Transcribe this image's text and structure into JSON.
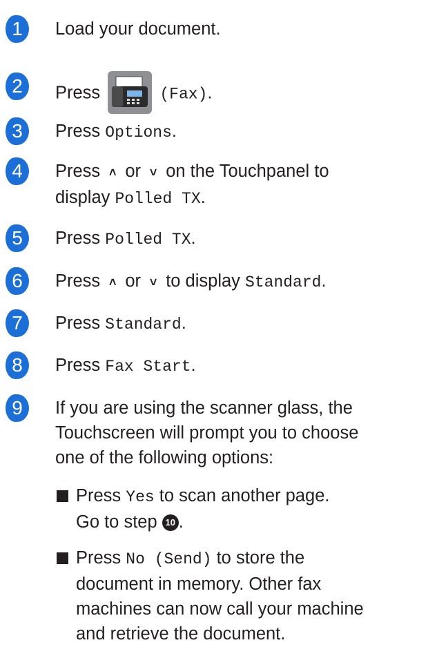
{
  "steps": [
    {
      "num": "1",
      "text": "Load your document."
    },
    {
      "num": "2",
      "pre": "Press",
      "post_mono": "(Fax)",
      "post": "."
    },
    {
      "num": "3",
      "pre": "Press ",
      "mono": "Options",
      "post": "."
    },
    {
      "num": "4",
      "pre": "Press ",
      "or": " or ",
      "mid": " on the Touchpanel to",
      "line2_pre": "display ",
      "line2_mono": "Polled TX",
      "line2_post": "."
    },
    {
      "num": "5",
      "pre": "Press ",
      "mono": "Polled TX",
      "post": "."
    },
    {
      "num": "6",
      "pre": "Press ",
      "or": " or ",
      "mid": " to display ",
      "mono": "Standard",
      "post": "."
    },
    {
      "num": "7",
      "pre": "Press ",
      "mono": "Standard",
      "post": "."
    },
    {
      "num": "8",
      "pre": "Press ",
      "mono": "Fax Start",
      "post": "."
    },
    {
      "num": "9",
      "line1": "If you are using the scanner glass, the",
      "line2": "Touchscreen will prompt you to choose",
      "line3": "one of the following options:"
    }
  ],
  "bullets": [
    {
      "pre": "Press ",
      "mono": "Yes",
      "post": " to scan another page.",
      "line2": "Go to step ",
      "ref": "10",
      "line2_post": "."
    },
    {
      "pre": "Press ",
      "mono": "No (Send)",
      "post": " to store the",
      "line2": "document in memory. Other fax",
      "line3": "machines can now call your machine",
      "line4": "and retrieve the document."
    }
  ],
  "icons": {
    "up": "chevron-up-icon",
    "down": "chevron-down-icon",
    "fax": "fax-machine-icon"
  },
  "colors": {
    "step_badge": "#1c6fd6",
    "fax_icon_bg": "#8e9094"
  }
}
